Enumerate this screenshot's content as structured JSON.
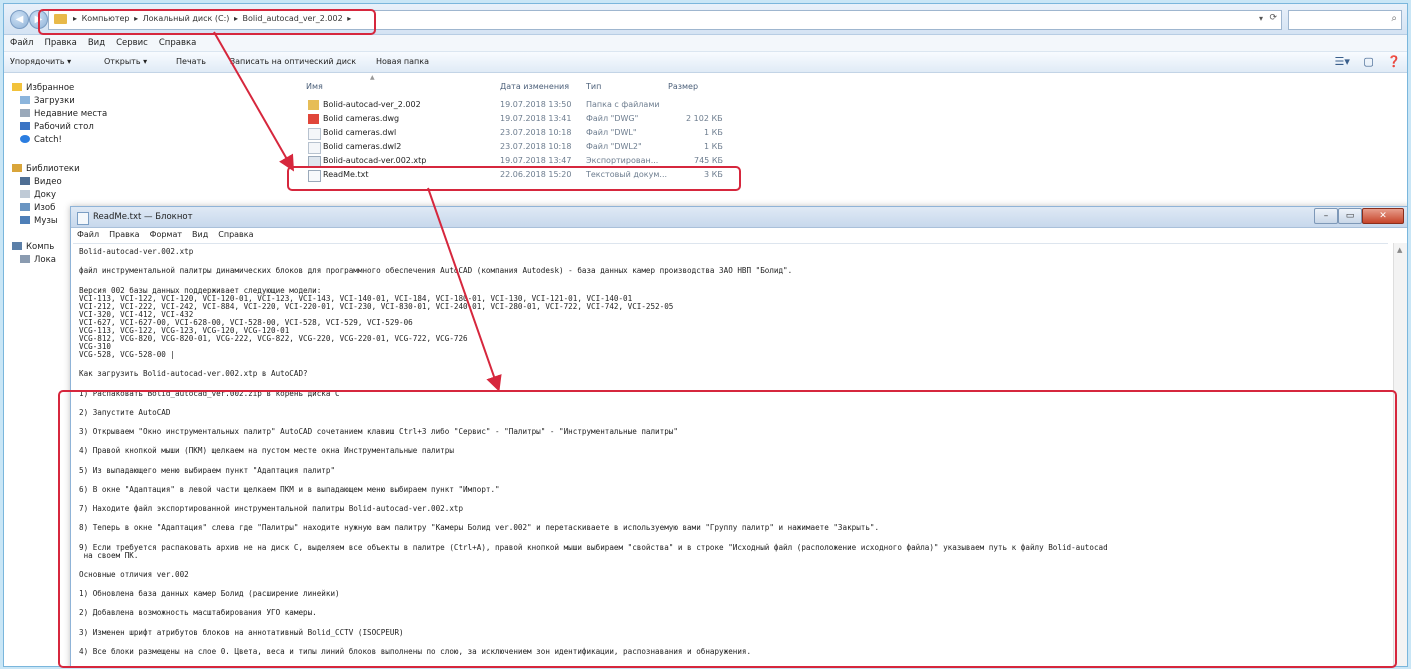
{
  "explorer": {
    "breadcrumbs": [
      "Компьютер",
      "Локальный диск (C:)",
      "Bolid_autocad_ver_2.002"
    ],
    "menu": [
      "Файл",
      "Правка",
      "Вид",
      "Сервис",
      "Справка"
    ],
    "toolbar": {
      "organize": "Упорядочить ▾",
      "open": "Открыть ▾",
      "print": "Печать",
      "burn": "Записать на оптический диск",
      "new_folder": "Новая папка"
    },
    "nav": {
      "favorites": "Избранное",
      "downloads": "Загрузки",
      "recent": "Недавние места",
      "desktop": "Рабочий стол",
      "catch": "Catch!",
      "libraries": "Библиотеки",
      "video": "Видео",
      "docs": "Доку",
      "images": "Изоб",
      "music": "Музы",
      "computer": "Компь",
      "local_disk": "Лока"
    },
    "columns": {
      "name": "Имя",
      "date": "Дата изменения",
      "type": "Тип",
      "size": "Размер"
    },
    "files": [
      {
        "name": "Bolid-autocad-ver_2.002",
        "date": "19.07.2018 13:50",
        "type": "Папка с файлами",
        "size": ""
      },
      {
        "name": "Bolid cameras.dwg",
        "date": "19.07.2018 13:41",
        "type": "Файл \"DWG\"",
        "size": "2 102 КБ"
      },
      {
        "name": "Bolid cameras.dwl",
        "date": "23.07.2018 10:18",
        "type": "Файл \"DWL\"",
        "size": "1 КБ"
      },
      {
        "name": "Bolid cameras.dwl2",
        "date": "23.07.2018 10:18",
        "type": "Файл \"DWL2\"",
        "size": "1 КБ"
      },
      {
        "name": "Bolid-autocad-ver.002.xtp",
        "date": "19.07.2018 13:47",
        "type": "Экспортирован...",
        "size": "745 КБ"
      },
      {
        "name": "ReadMe.txt",
        "date": "22.06.2018 15:20",
        "type": "Текстовый докум...",
        "size": "3 КБ"
      }
    ]
  },
  "notepad": {
    "title": "ReadMe.txt — Блокнот",
    "menu": [
      "Файл",
      "Правка",
      "Формат",
      "Вид",
      "Справка"
    ],
    "lines": [
      "Bolid-autocad-ver.002.xtp",
      "файл инструментальной палитры динамических блоков для программного обеспечения AutoCAD (компания Autodesk) - база данных камер производства ЗАО НВП \"Болид\".",
      "Версия 002 базы данных поддерживает следующие модели:",
      "VCI-113, VCI-122, VCI-120, VCI-120-01, VCI-123, VCI-143, VCI-140-01, VCI-184, VCI-180-01, VCI-130, VCI-121-01, VCI-140-01",
      "VCI-212, VCI-222, VCI-242, VCI-884, VCI-220, VCI-220-01, VCI-230, VCI-830-01, VCI-240-01, VCI-280-01, VCI-722, VCI-742, VCI-252-05",
      "VCI-320, VCI-412, VCI-432",
      "VCI-627, VCI-627-00, VCI-628-00, VCI-528-00, VCI-528, VCI-529, VCI-529-06",
      "VCG-113, VCG-122, VCG-123, VCG-120, VCG-120-01",
      "VCG-812, VCG-820, VCG-820-01, VCG-222, VCG-822, VCG-220, VCG-220-01, VCG-722, VCG-726",
      "VCG-310",
      "VCG-528, VCG-528-00 |",
      "Как загрузить Bolid-autocad-ver.002.xtp в AutoCAD?",
      "1) Распаковать Bolid_autocad_ver.002.zip в корень диска C",
      "2) Запустите AutoCAD",
      "3) Открываем \"Окно инструментальных палитр\" AutoCAD сочетанием клавиш Ctrl+3 либо \"Сервис\" - \"Палитры\" - \"Инструментальные палитры\"",
      "4) Правой кнопкой мыши (ПКМ) щелкаем на пустом месте окна Инструментальные палитры",
      "5) Из выпадающего меню выбираем пункт \"Адаптация палитр\"",
      "6) В окне \"Адаптация\" в левой части щелкаем ПКМ и в выпадающем меню выбираем пункт \"Импорт.\"",
      "7) Находите файл экспортированной инструментальной палитры Bolid-autocad-ver.002.xtp",
      "8) Теперь в окне \"Адаптация\" слева где \"Палитры\" находите нужную вам палитру \"Камеры Болид ver.002\" и перетаскиваете в используемую вами \"Группу палитр\" и нажимаете \"Закрыть\".",
      "9) Если требуется распаковать архив не на диск C, выделяем все объекты в палитре (Ctrl+A), правой кнопкой мыши выбираем \"свойства\" и в строке \"Исходный файл (расположение исходного файла)\" указываем путь к файлу Bolid-autocad",
      " на своем ПК.",
      "Основные отличия ver.002",
      "1) Обновлена база данных камер Болид (расширение линейки)",
      "2) Добавлена возможность масштабирования УГО камеры.",
      "3) Изменен шрифт атрибутов блоков на аннотативный Bolid_CCTV (ISOCPEUR)",
      "4) Все блоки размещены на слое 0. Цвета, веса и типы линий блоков выполнены по слою, за исключением зон идентификации, распознавания и обнаружения."
    ]
  },
  "colors": {
    "highlight": "#d6273d",
    "chrome": "#c9e6f6"
  }
}
